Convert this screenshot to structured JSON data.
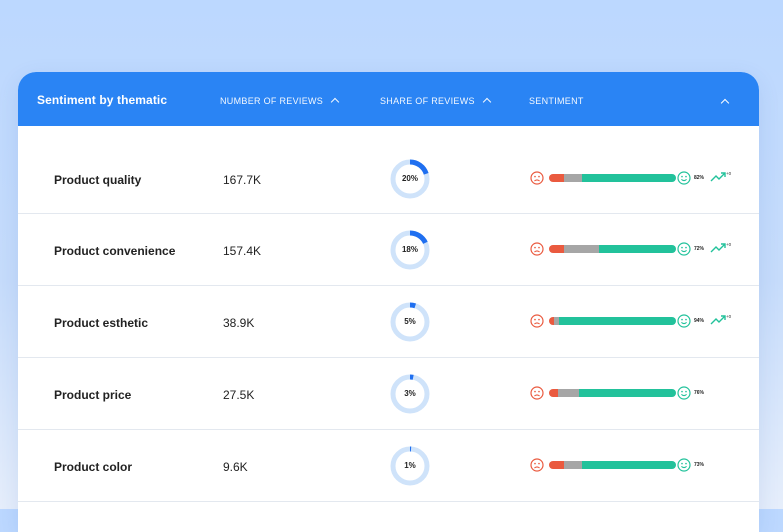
{
  "header": {
    "title": "Sentiment by thematic",
    "col_reviews": "NUMBER OF REVIEWS",
    "col_share": "SHARE OF REVIEWS",
    "col_sentiment": "SENTIMENT"
  },
  "colors": {
    "header_bg": "#2a84f4",
    "donut_track": "#cfe3fa",
    "donut_fill": "#1f6ff0",
    "negative": "#ea5a3f",
    "neutral": "#a6a6a6",
    "positive": "#22c29b"
  },
  "icons": [
    "sad-face-icon",
    "happy-face-icon",
    "trend-up-icon",
    "chevron-up-icon"
  ],
  "rows": [
    {
      "name": "Product quality",
      "count": "167.7K",
      "share": 20,
      "share_label": "20%",
      "negative": 0.12,
      "neutral": 0.14,
      "positive": 0.74,
      "positive_label": "82%",
      "delta": "+0",
      "trend": true
    },
    {
      "name": "Product convenience",
      "count": "157.4K",
      "share": 18,
      "share_label": "18%",
      "negative": 0.12,
      "neutral": 0.27,
      "positive": 0.61,
      "positive_label": "72%",
      "delta": "+0",
      "trend": true
    },
    {
      "name": "Product esthetic",
      "count": "38.9K",
      "share": 5,
      "share_label": "5%",
      "negative": 0.04,
      "neutral": 0.04,
      "positive": 0.92,
      "positive_label": "94%",
      "delta": "+0",
      "trend": true
    },
    {
      "name": "Product price",
      "count": "27.5K",
      "share": 3,
      "share_label": "3%",
      "negative": 0.07,
      "neutral": 0.17,
      "positive": 0.76,
      "positive_label": "76%",
      "delta": "",
      "trend": false
    },
    {
      "name": "Product color",
      "count": "9.6K",
      "share": 1,
      "share_label": "1%",
      "negative": 0.12,
      "neutral": 0.14,
      "positive": 0.74,
      "positive_label": "73%",
      "delta": "",
      "trend": false
    }
  ]
}
